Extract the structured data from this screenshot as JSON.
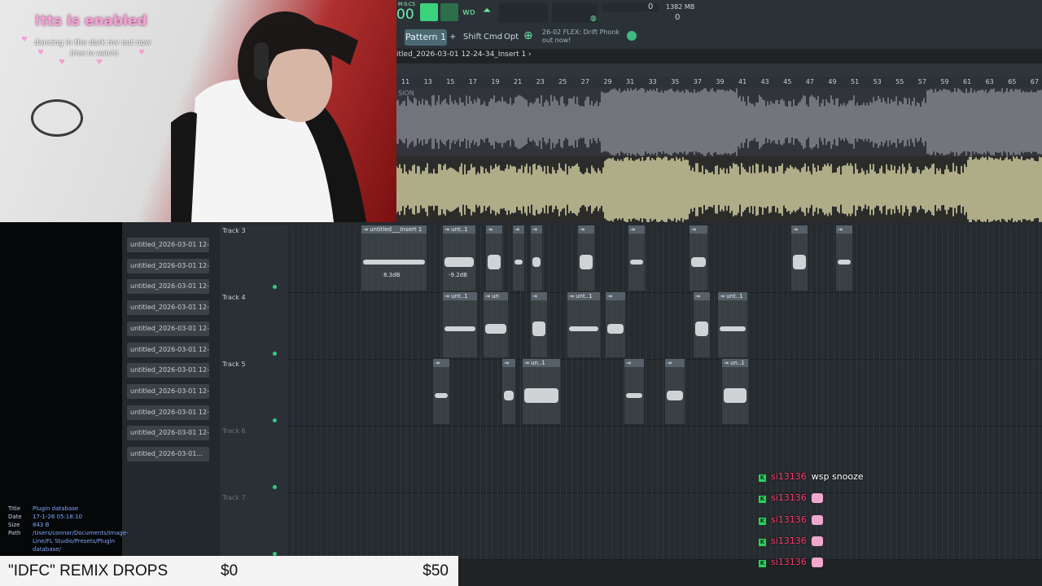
{
  "overlay": {
    "tts_status": "!tts is enabled",
    "song_line": "dancing in the dark mv out now",
    "song_sub": "(free to watch)"
  },
  "fl": {
    "pattern_label": "Pattern 1",
    "plus_label": "+",
    "shift_label": "Shift",
    "cmd_label": "Cmd",
    "opt_label": "Opt",
    "tempo_display": "00",
    "memory": "1382 MB",
    "counter_top": "0",
    "counter_bottom": "0",
    "hint_date": "26-02",
    "hint_text": "FLEX: Drift Phonk",
    "hint_sub": "out now!",
    "playlist_title": "itled_2026-03-01 12-24-34_Insert 1 ›",
    "wave_label": "SION",
    "ruler": [
      "11",
      "13",
      "15",
      "17",
      "19",
      "21",
      "23",
      "25",
      "27",
      "29",
      "31",
      "33",
      "35",
      "37",
      "39",
      "41",
      "43",
      "45",
      "47",
      "49",
      "51",
      "53",
      "55",
      "57",
      "59",
      "61",
      "63",
      "65",
      "67"
    ]
  },
  "browser": {
    "items": [
      "untitled_2026-03-01 12-...",
      "untitled_2026-03-01 12-...",
      "untitled_2026-03-01 12-...",
      "untitled_2026-03-01 12-...",
      "untitled_2026-03-01 12-...",
      "untitled_2026-03-01 12-...",
      "untitled_2026-03-01 12-...",
      "untitled_2026-03-01 12-...",
      "untitled_2026-03-01 12-...",
      "untitled_2026-03-01 12-...",
      "untitled_2026-03-01..."
    ]
  },
  "tracks": [
    {
      "name": "Track 3",
      "clips": [
        {
          "label": "untitled___Insert 1",
          "db": "8.3dB"
        },
        {
          "label": "unt..1",
          "db": "-9.2dB"
        }
      ]
    },
    {
      "name": "Track 4",
      "clips": [
        {
          "label": "unt..1"
        },
        {
          "label": "un"
        },
        {
          "label": "unt..1"
        },
        {
          "label": "unt..1"
        }
      ]
    },
    {
      "name": "Track 5",
      "clips": [
        {
          "label": "un..1"
        },
        {
          "label": "un..1"
        }
      ]
    },
    {
      "name": "Track 6",
      "clips": []
    },
    {
      "name": "Track 7",
      "clips": []
    }
  ],
  "info": {
    "title_key": "Title",
    "title_val": "Plugin database",
    "date_key": "Date",
    "date_val": "17-1-26 05:18:10",
    "size_key": "Size",
    "size_val": "843 B",
    "path_key": "Path",
    "path_val": "/Users/connor/Documents/Image-Line/FL Studio/Presets/Plugin database/"
  },
  "donation": {
    "title": "\"IDFC\" REMIX DROPS",
    "start": "$0",
    "goal": "$50"
  },
  "chat": [
    {
      "user": "si13136",
      "msg": "wsp snooze"
    },
    {
      "user": "si13136",
      "msg": ""
    },
    {
      "user": "si13136",
      "msg": ""
    },
    {
      "user": "si13136",
      "msg": ""
    },
    {
      "user": "si13136",
      "msg": ""
    }
  ],
  "colors": {
    "accent": "#36c98a",
    "waveform": "#e8e4b0",
    "chat_user": "#ff3c6e",
    "tts": "#f7a1d2"
  }
}
